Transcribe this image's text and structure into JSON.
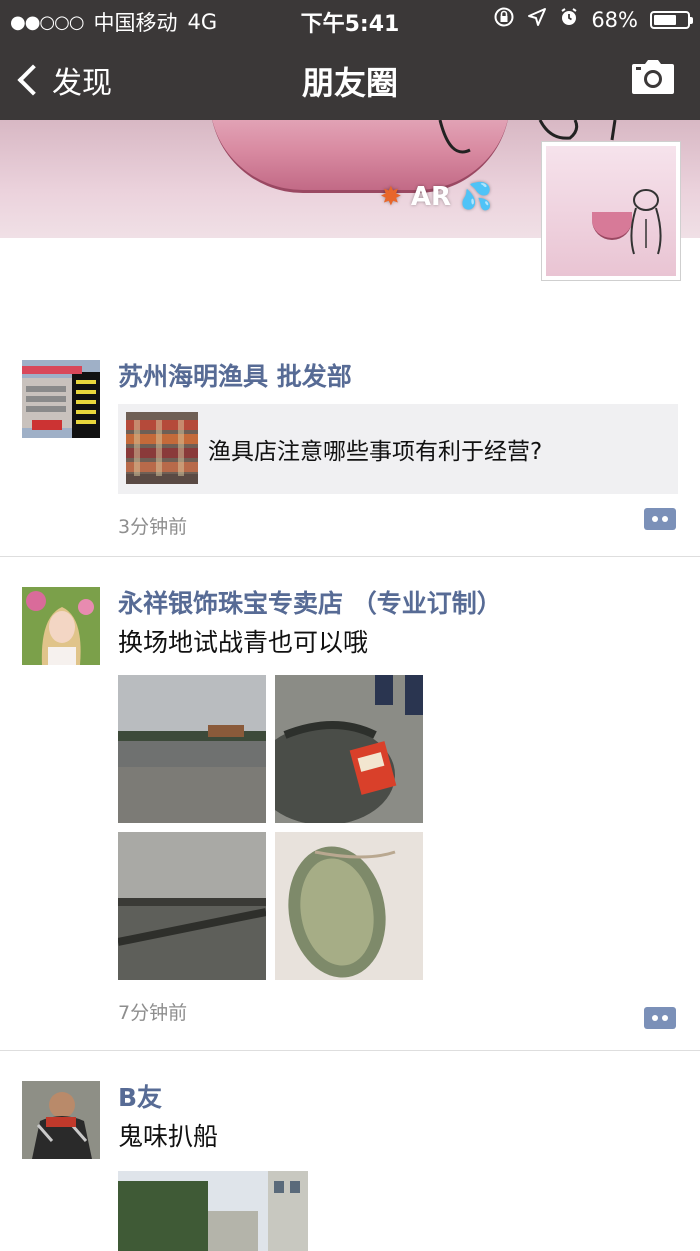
{
  "status": {
    "carrier": "中国移动",
    "network": "4G",
    "time": "下午5:41",
    "battery_text": "68%",
    "battery_level": 0.68
  },
  "nav": {
    "back_label": "发现",
    "title": "朋友圈"
  },
  "cover": {
    "ar_text": "AR"
  },
  "posts": [
    {
      "name": "苏州海明渔具 批发部",
      "share_title": "渔具店注意哪些事项有利于经营?",
      "time": "3分钟前"
    },
    {
      "name": "永祥银饰珠宝专卖店 （专业订制）",
      "text": "换场地试战青也可以哦",
      "time": "7分钟前"
    },
    {
      "name": "B友",
      "text": "鬼味扒船"
    }
  ],
  "colors": {
    "name_blue": "#576b95",
    "header_bg": "#3b3838"
  }
}
